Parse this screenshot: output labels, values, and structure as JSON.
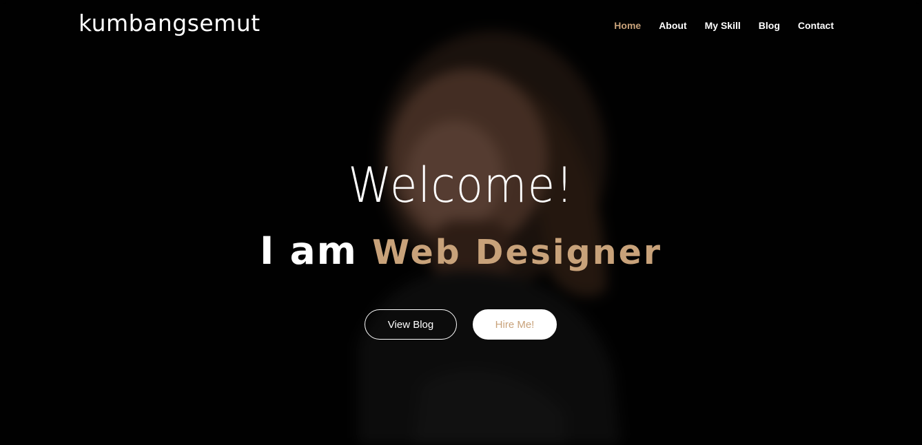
{
  "brand": {
    "logo_text": "kumbangsemut"
  },
  "nav": {
    "items": [
      {
        "label": "Home",
        "active": true
      },
      {
        "label": "About",
        "active": false
      },
      {
        "label": "My Skill",
        "active": false
      },
      {
        "label": "Blog",
        "active": false
      },
      {
        "label": "Contact",
        "active": false
      }
    ]
  },
  "hero": {
    "welcome": "Welcome!",
    "tagline_lead": "I am",
    "tagline_role": "Web Designer",
    "buttons": {
      "view_blog": "View Blog",
      "hire_me": "Hire Me!"
    }
  },
  "colors": {
    "accent": "#c8a27a",
    "background": "#000000",
    "text": "#ffffff"
  }
}
